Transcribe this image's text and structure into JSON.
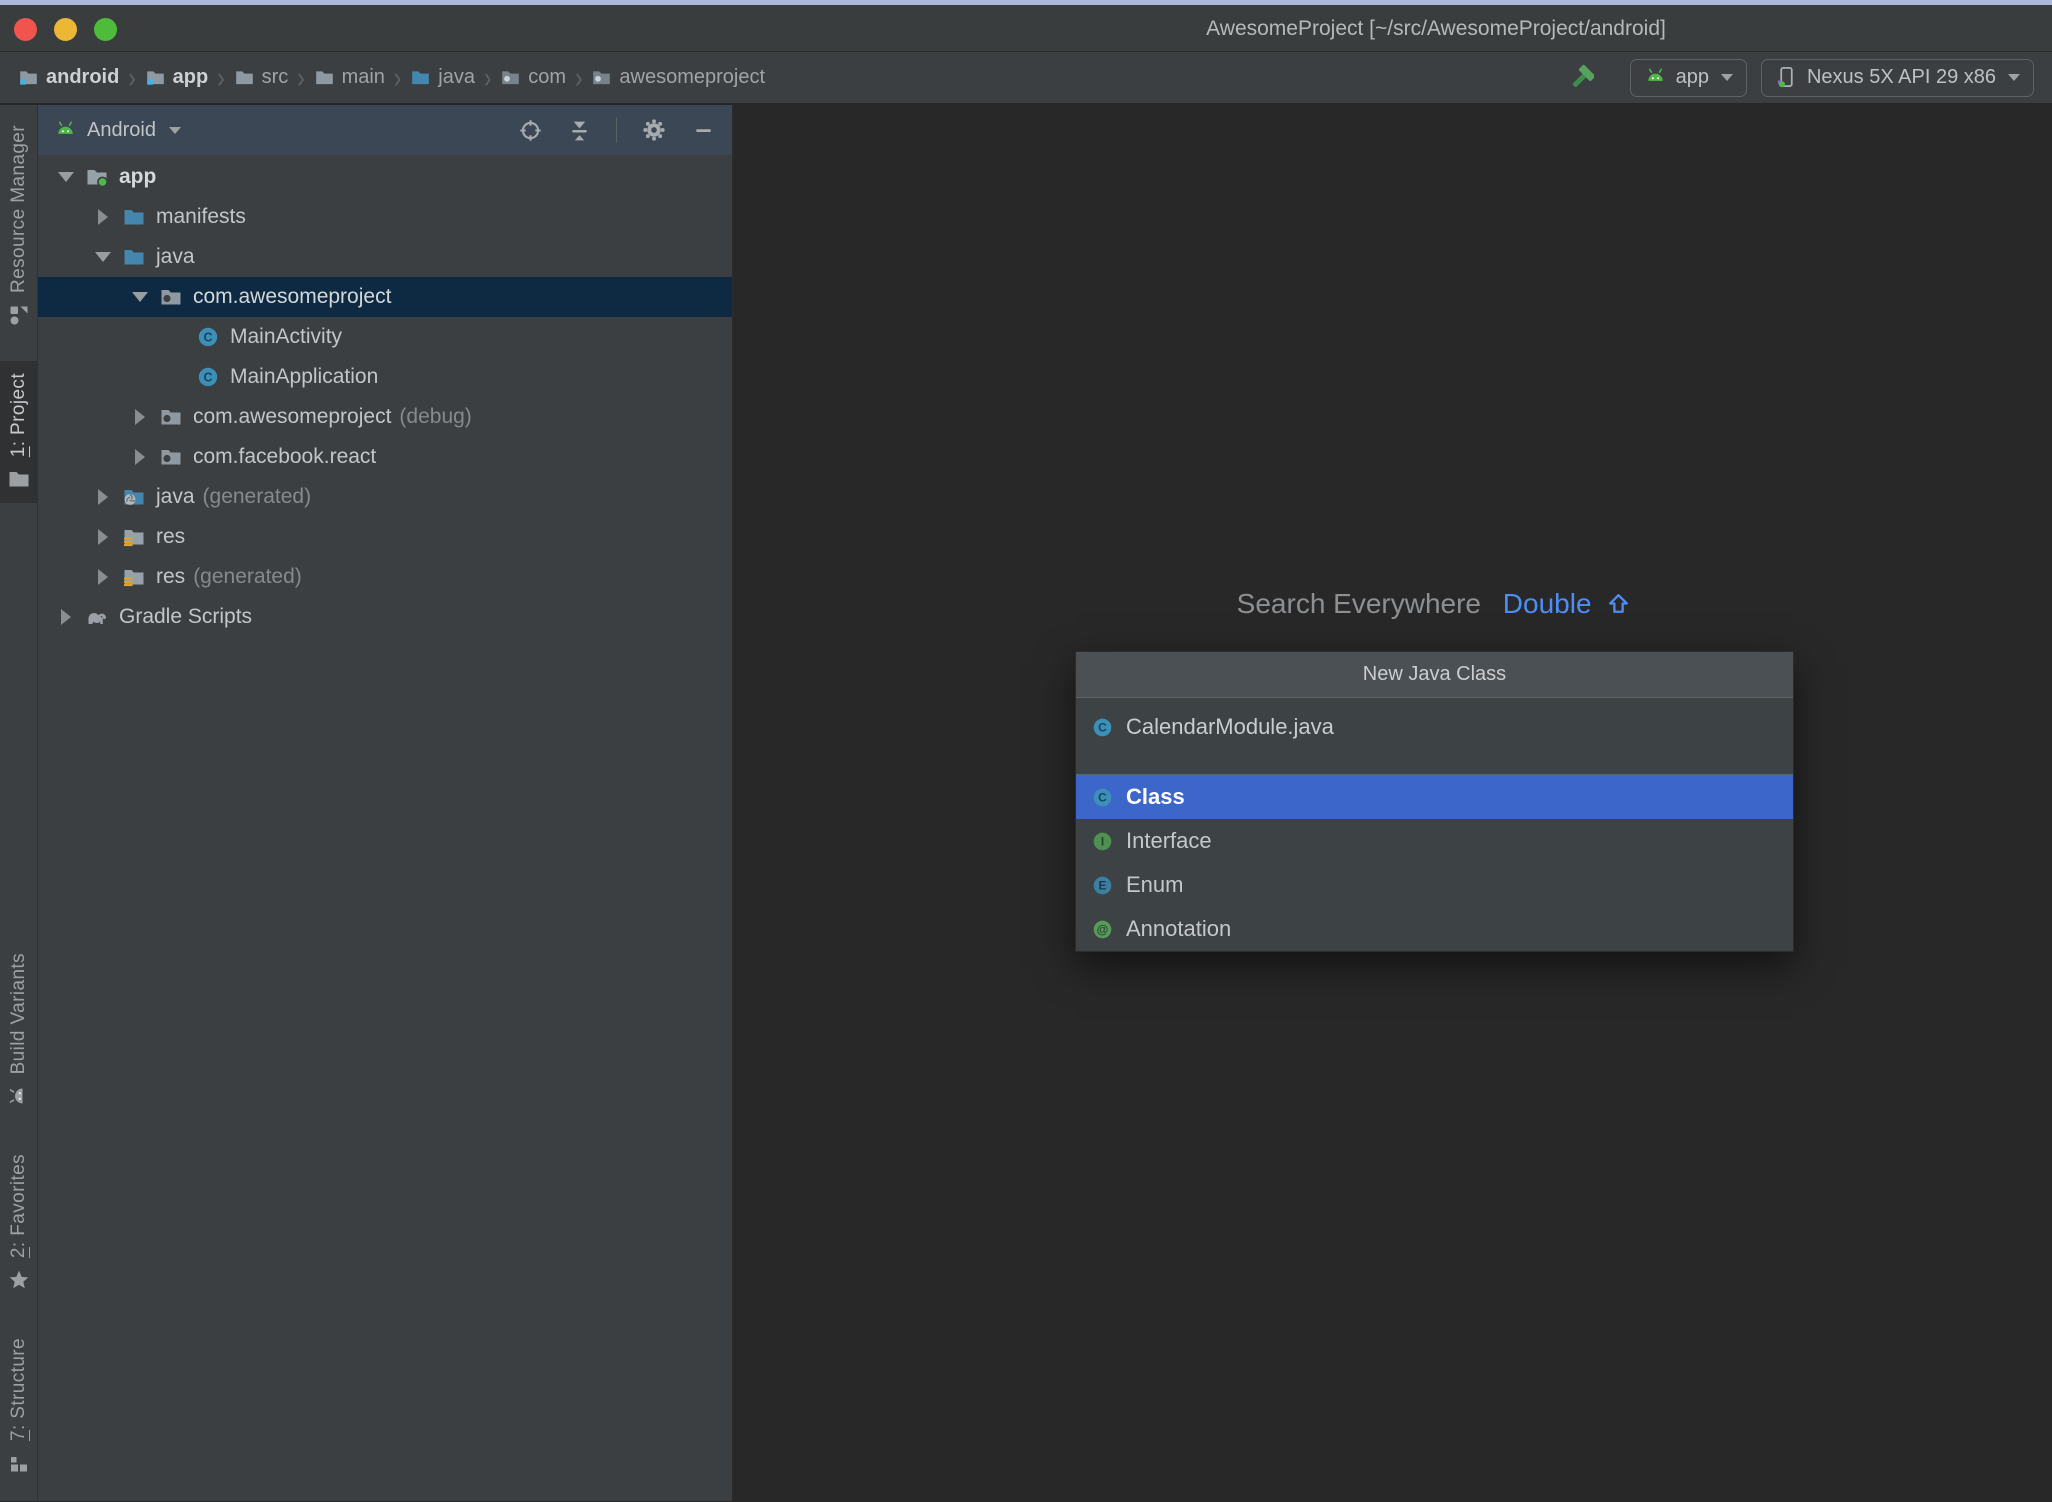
{
  "window": {
    "title": "AwesomeProject [~/src/AwesomeProject/android]",
    "controls": [
      "close",
      "minimize",
      "zoom"
    ]
  },
  "breadcrumbs": {
    "separator": "›",
    "items": [
      {
        "label": "android",
        "icon": "module-folder-icon",
        "bold": true
      },
      {
        "label": "app",
        "icon": "module-folder-icon",
        "bold": true
      },
      {
        "label": "src",
        "icon": "folder-icon",
        "bold": false
      },
      {
        "label": "main",
        "icon": "folder-icon",
        "bold": false
      },
      {
        "label": "java",
        "icon": "source-folder-icon",
        "bold": false
      },
      {
        "label": "com",
        "icon": "package-icon",
        "bold": false
      },
      {
        "label": "awesomeproject",
        "icon": "package-icon",
        "bold": false
      }
    ]
  },
  "toolbar": {
    "build_icon": "hammer-icon",
    "run_config": {
      "label": "app",
      "icon": "android-icon"
    },
    "device": {
      "label": "Nexus 5X API 29 x86",
      "icon": "phone-icon"
    }
  },
  "stripe": {
    "top": [
      {
        "label": "Resource Manager",
        "icon": "resource-manager-icon",
        "active": false,
        "mnemonic": ""
      },
      {
        "label": "1: Project",
        "icon": "project-folder-icon",
        "active": true,
        "mnemonic": "1"
      }
    ],
    "bottom": [
      {
        "label": "Build Variants",
        "icon": "android-gray-icon",
        "active": false,
        "mnemonic": ""
      },
      {
        "label": "2: Favorites",
        "icon": "star-icon",
        "active": false,
        "mnemonic": "2"
      },
      {
        "label": "7: Structure",
        "icon": "structure-icon",
        "active": false,
        "mnemonic": "7"
      }
    ]
  },
  "project_panel": {
    "view_selector": "Android",
    "header_icons": [
      "locate-icon",
      "collapse-all-icon",
      "gear-icon",
      "hide-icon"
    ],
    "tree": [
      {
        "label": "app",
        "suffix": "",
        "icon": "module-folder-icon",
        "arrow": "expanded",
        "level": 0,
        "selected": false,
        "bold": true
      },
      {
        "label": "manifests",
        "suffix": "",
        "icon": "source-folder-icon",
        "arrow": "collapsed",
        "level": 1,
        "selected": false,
        "bold": false
      },
      {
        "label": "java",
        "suffix": "",
        "icon": "source-folder-icon",
        "arrow": "expanded",
        "level": 1,
        "selected": false,
        "bold": false
      },
      {
        "label": "com.awesomeproject",
        "suffix": "",
        "icon": "package-icon",
        "arrow": "expanded",
        "level": 2,
        "selected": true,
        "bold": false
      },
      {
        "label": "MainActivity",
        "suffix": "",
        "icon": "class-icon",
        "arrow": "none",
        "level": 3,
        "selected": false,
        "bold": false
      },
      {
        "label": "MainApplication",
        "suffix": "",
        "icon": "class-icon",
        "arrow": "none",
        "level": 3,
        "selected": false,
        "bold": false
      },
      {
        "label": "com.awesomeproject",
        "suffix": "(debug)",
        "icon": "package-icon",
        "arrow": "collapsed",
        "level": 2,
        "selected": false,
        "bold": false
      },
      {
        "label": "com.facebook.react",
        "suffix": "",
        "icon": "package-icon",
        "arrow": "collapsed",
        "level": 2,
        "selected": false,
        "bold": false
      },
      {
        "label": "java",
        "suffix": "(generated)",
        "icon": "generated-source-folder-icon",
        "arrow": "collapsed",
        "level": 1,
        "selected": false,
        "bold": false
      },
      {
        "label": "res",
        "suffix": "",
        "icon": "res-folder-icon",
        "arrow": "collapsed",
        "level": 1,
        "selected": false,
        "bold": false
      },
      {
        "label": "res",
        "suffix": "(generated)",
        "icon": "res-folder-icon",
        "arrow": "collapsed",
        "level": 1,
        "selected": false,
        "bold": false
      },
      {
        "label": "Gradle Scripts",
        "suffix": "",
        "icon": "gradle-icon",
        "arrow": "collapsed",
        "level": 0,
        "selected": false,
        "bold": false
      }
    ]
  },
  "editor_hint": {
    "text": "Search Everywhere",
    "shortcut_label": "Double",
    "shortcut_symbol_icon": "shift-arrow-icon"
  },
  "popup": {
    "title": "New Java Class",
    "filename": "CalendarModule.java",
    "filename_icon": "class-icon",
    "kinds": [
      {
        "label": "Class",
        "icon": "class-icon",
        "selected": true
      },
      {
        "label": "Interface",
        "icon": "interface-icon",
        "selected": false
      },
      {
        "label": "Enum",
        "icon": "enum-icon",
        "selected": false
      },
      {
        "label": "Annotation",
        "icon": "annotation-icon",
        "selected": false
      }
    ]
  },
  "colors": {
    "top_strip": "#a9b7d8",
    "titlebar_bg": "#3a3d3e",
    "toolbar_bg": "#3c3f41",
    "panel_bg": "#3b3f42",
    "panel_header_bg": "#3b4754",
    "editor_bg": "#282828",
    "stripe_bg": "#3c3f41",
    "stripe_active_bg": "#2f3133",
    "tree_selected_bg": "#0d2a42",
    "list_selected_bg": "#3d66cb",
    "popup_bg": "#3d4245",
    "popup_header_bg": "#4b5054",
    "separator": "#5e6366",
    "accent_blue": "#4d8dfa",
    "android_green": "#50b848",
    "folder_blue": "#4486ad",
    "folder_gray": "#97a1a9",
    "res_orange": "#d9a23c",
    "class_icon": "#3c90b8",
    "interface_icon": "#4f8f51",
    "enum_icon": "#3d7fa0",
    "annotation_icon": "#589a58",
    "traffic_red": "#f0544c",
    "traffic_yellow": "#ebb734",
    "traffic_green": "#4ebb3a",
    "hammer_green": "#55a35c",
    "text_primary": "#c2c6c9",
    "text_dim": "#868a8d"
  }
}
